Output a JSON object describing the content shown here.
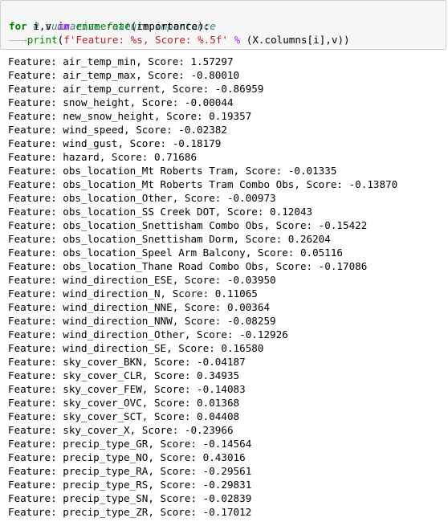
{
  "code": {
    "comment": "# summarize feature importance",
    "line2": {
      "kw_for": "for",
      "vars": " i,v ",
      "kw_in": "in",
      "space": " ",
      "func": "enumerate",
      "rest": "(importance):"
    },
    "line3": {
      "indent_arrow": "——→",
      "func": "print",
      "open": "(",
      "fstr": "f'Feature: %s, Score: %.5f'",
      "op": " % ",
      "rest": "(X.columns[i],v))"
    }
  },
  "output": [
    "Feature: air_temp_min, Score: 1.57297",
    "Feature: air_temp_max, Score: -0.80010",
    "Feature: air_temp_current, Score: -0.86959",
    "Feature: snow_height, Score: -0.00044",
    "Feature: new_snow_height, Score: 0.19357",
    "Feature: wind_speed, Score: -0.02382",
    "Feature: wind_gust, Score: -0.18179",
    "Feature: hazard, Score: 0.71686",
    "Feature: obs_location_Mt Roberts Tram, Score: -0.01335",
    "Feature: obs_location_Mt Roberts Tram Combo Obs, Score: -0.13870",
    "Feature: obs_location_Other, Score: -0.00973",
    "Feature: obs_location_SS Creek DOT, Score: 0.12043",
    "Feature: obs_location_Snettisham Combo Obs, Score: -0.15422",
    "Feature: obs_location_Snettisham Dorm, Score: 0.26204",
    "Feature: obs_location_Speel Arm Balcony, Score: 0.05116",
    "Feature: obs_location_Thane Road Combo Obs, Score: -0.17086",
    "Feature: wind_direction_ESE, Score: -0.03950",
    "Feature: wind_direction_N, Score: 0.11065",
    "Feature: wind_direction_NNE, Score: 0.00364",
    "Feature: wind_direction_NNW, Score: -0.08259",
    "Feature: wind_direction_Other, Score: -0.12926",
    "Feature: wind_direction_SE, Score: 0.16580",
    "Feature: sky_cover_BKN, Score: -0.04187",
    "Feature: sky_cover_CLR, Score: 0.34935",
    "Feature: sky_cover_FEW, Score: -0.14083",
    "Feature: sky_cover_OVC, Score: 0.01368",
    "Feature: sky_cover_SCT, Score: 0.04408",
    "Feature: sky_cover_X, Score: -0.23966",
    "Feature: precip_type_GR, Score: -0.14564",
    "Feature: precip_type_NO, Score: 0.43016",
    "Feature: precip_type_RA, Score: -0.29561",
    "Feature: precip_type_RS, Score: -0.29831",
    "Feature: precip_type_SN, Score: -0.02839",
    "Feature: precip_type_ZR, Score: -0.17012"
  ]
}
